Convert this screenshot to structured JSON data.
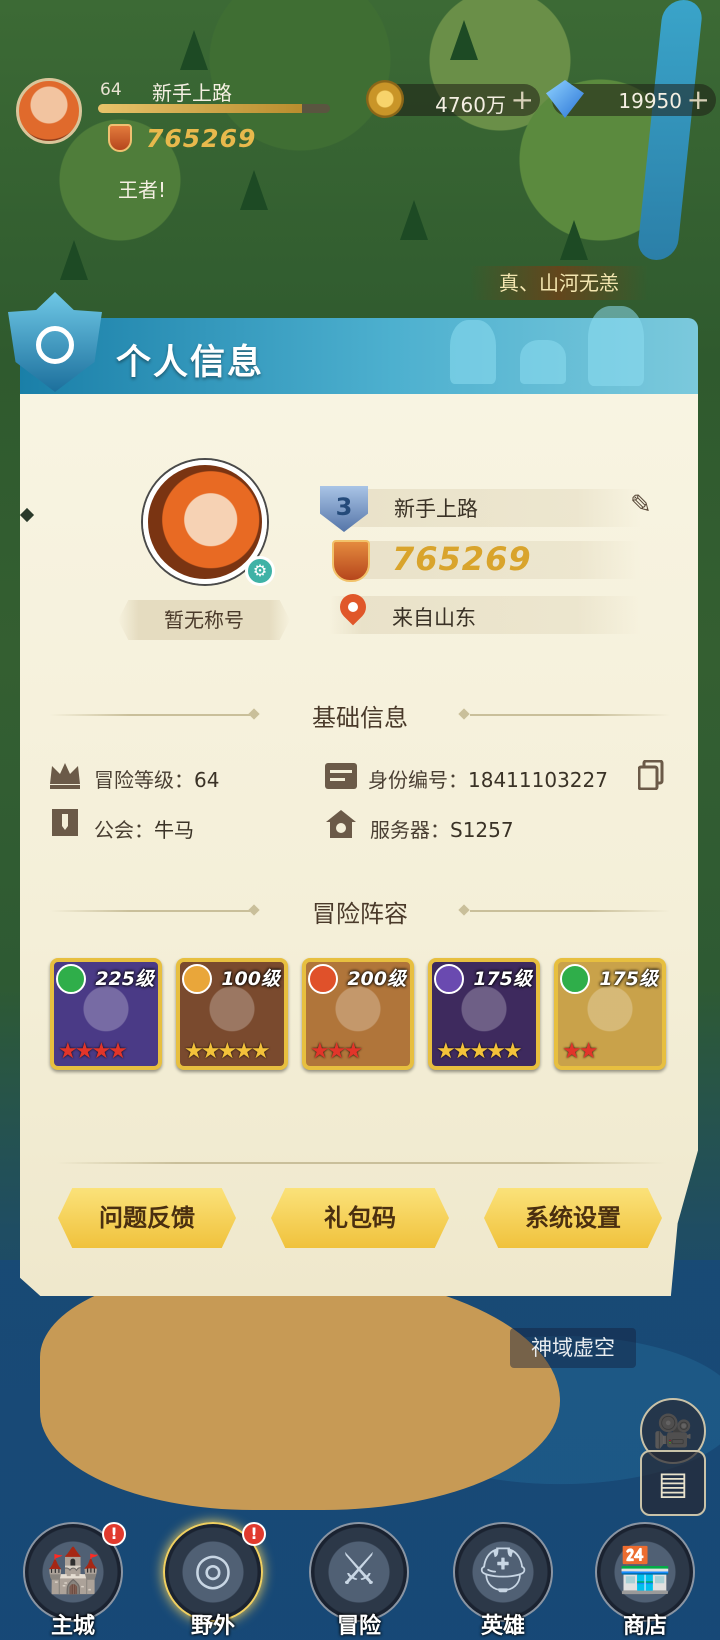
{
  "status": {
    "level": "64",
    "name": "新手上路",
    "xp_fraction": 0.88,
    "power": "765269",
    "motto": "王者!",
    "gold": "4760万",
    "gems": "19950",
    "plus": "+"
  },
  "map": {
    "rank_tag": "真、山河无恙",
    "zone_label": "神域虚空"
  },
  "panel": {
    "title": "个人信息",
    "title_badge": "暂无称号",
    "player_level": "3",
    "player_name": "新手上路",
    "power": "765269",
    "location": "来自山东",
    "basic_title": "基础信息",
    "adventure_level_label": "冒险等级：",
    "adventure_level": "64",
    "id_label": "身份编号：",
    "id_value": "18411103227",
    "guild_label": "公会：",
    "guild_value": "牛马",
    "server_label": "服务器：",
    "server_value": "S1257",
    "lineup_title": "冒险阵容",
    "heroes": [
      {
        "level": "225级",
        "stars": "★★★★",
        "faction_color": "#2fae4a",
        "bg": "#4a3a86",
        "star_color": "#e2352a"
      },
      {
        "level": "100级",
        "stars": "★★★★★",
        "faction_color": "#e9a63a",
        "bg": "#7a4a2e",
        "star_color": "#f3c23a"
      },
      {
        "level": "200级",
        "stars": "★★★",
        "faction_color": "#e0512a",
        "bg": "#b0753a",
        "star_color": "#e2352a"
      },
      {
        "level": "175级",
        "stars": "★★★★★",
        "faction_color": "#6a4ab0",
        "bg": "#3e2a5e",
        "star_color": "#f3c23a"
      },
      {
        "level": "175级",
        "stars": "★★",
        "faction_color": "#2fae4a",
        "bg": "#c9a24a",
        "star_color": "#e2352a"
      }
    ],
    "buttons": {
      "feedback": "问题反馈",
      "gift_code": "礼包码",
      "settings": "系统设置"
    }
  },
  "nav": [
    {
      "label": "主城",
      "alert": "!"
    },
    {
      "label": "野外",
      "alert": "!"
    },
    {
      "label": "冒险"
    },
    {
      "label": "英雄"
    },
    {
      "label": "商店"
    }
  ]
}
